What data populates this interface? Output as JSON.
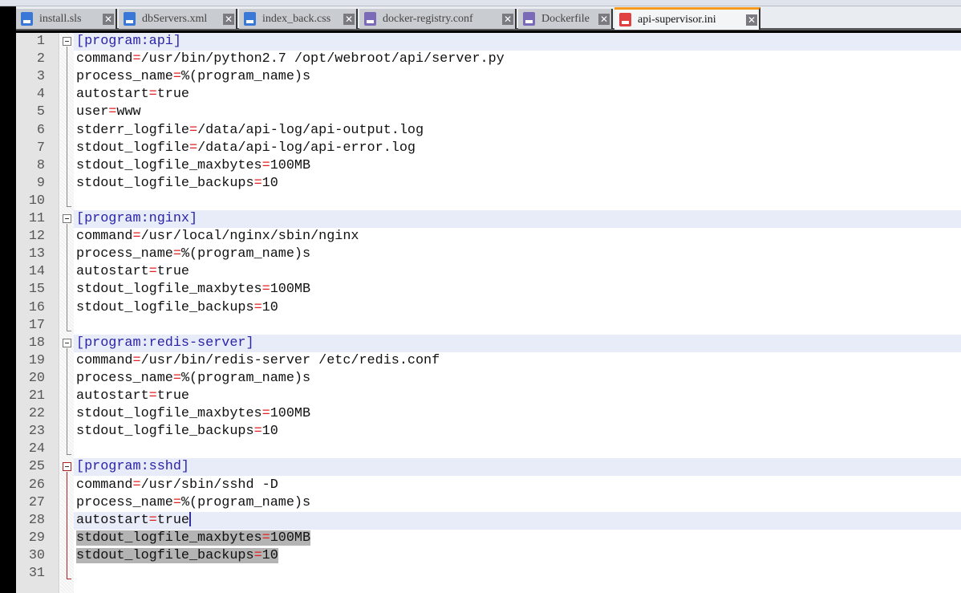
{
  "tabs": [
    {
      "label": "install.sls",
      "icon": "file-saved-icon",
      "color": "#3a78d8",
      "active": false
    },
    {
      "label": "dbServers.xml",
      "icon": "file-saved-icon",
      "color": "#3a78d8",
      "active": false
    },
    {
      "label": "index_back.css",
      "icon": "file-saved-icon",
      "color": "#3a78d8",
      "active": false
    },
    {
      "label": "docker-registry.conf",
      "icon": "file-saved-icon",
      "color": "#7a6ab8",
      "active": false
    },
    {
      "label": "Dockerfile",
      "icon": "file-saved-icon",
      "color": "#7a6ab8",
      "active": false
    },
    {
      "label": "api-supervisor.ini",
      "icon": "file-modified-icon",
      "color": "#e04040",
      "active": true
    }
  ],
  "close_glyph": "✕",
  "current_line": 28,
  "selected_lines": [
    29,
    30
  ],
  "lines": [
    {
      "section": "[program:api]"
    },
    {
      "key": "command",
      "value": "/usr/bin/python2.7 /opt/webroot/api/server.py"
    },
    {
      "key": "process_name",
      "value": "%(program_name)s"
    },
    {
      "key": "autostart",
      "value": "true"
    },
    {
      "key": "user",
      "value": "www"
    },
    {
      "key": "stderr_logfile",
      "value": "/data/api-log/api-output.log"
    },
    {
      "key": "stdout_logfile",
      "value": "/data/api-log/api-error.log"
    },
    {
      "key": "stdout_logfile_maxbytes",
      "value": "100MB"
    },
    {
      "key": "stdout_logfile_backups",
      "value": "10"
    },
    {},
    {
      "section": "[program:nginx]"
    },
    {
      "key": "command",
      "value": "/usr/local/nginx/sbin/nginx"
    },
    {
      "key": "process_name",
      "value": "%(program_name)s"
    },
    {
      "key": "autostart",
      "value": "true"
    },
    {
      "key": "stdout_logfile_maxbytes",
      "value": "100MB"
    },
    {
      "key": "stdout_logfile_backups",
      "value": "10"
    },
    {},
    {
      "section": "[program:redis-server]"
    },
    {
      "key": "command",
      "value": "/usr/bin/redis-server /etc/redis.conf"
    },
    {
      "key": "process_name",
      "value": "%(program_name)s"
    },
    {
      "key": "autostart",
      "value": "true"
    },
    {
      "key": "stdout_logfile_maxbytes",
      "value": "100MB"
    },
    {
      "key": "stdout_logfile_backups",
      "value": "10"
    },
    {},
    {
      "section": "[program:sshd]"
    },
    {
      "key": "command",
      "value": "/usr/sbin/sshd -D"
    },
    {
      "key": "process_name",
      "value": "%(program_name)s"
    },
    {
      "key": "autostart",
      "value": "true"
    },
    {
      "key": "stdout_logfile_maxbytes",
      "value": "100MB"
    },
    {
      "key": "stdout_logfile_backups",
      "value": "10"
    },
    {}
  ]
}
